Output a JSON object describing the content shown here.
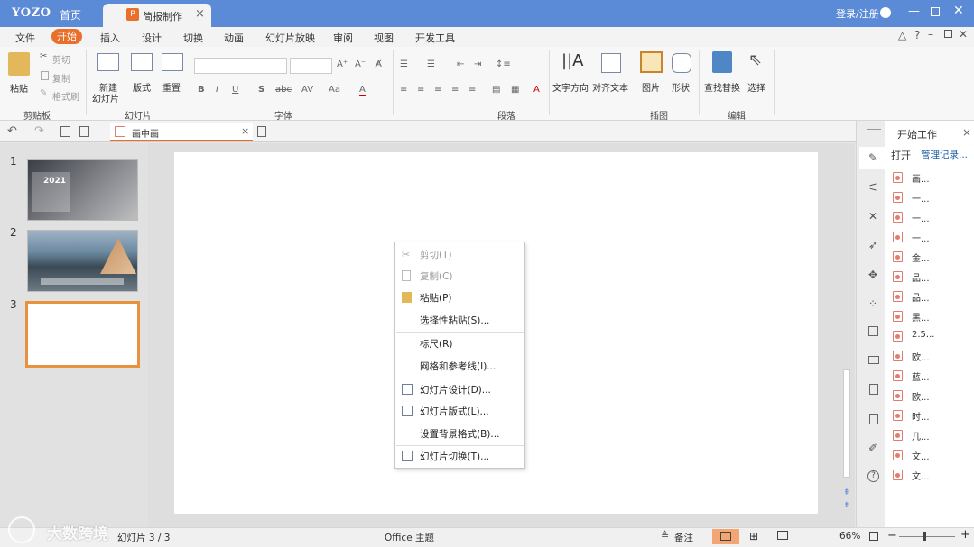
{
  "titlebar": {
    "logo": "YOZO",
    "home_tab": "首页",
    "doc_tab": "简报制作",
    "doc_icon": "P",
    "login": "登录/注册"
  },
  "menu": [
    "文件",
    "开始",
    "插入",
    "设计",
    "切换",
    "动画",
    "幻灯片放映",
    "审阅",
    "视图",
    "开发工具"
  ],
  "ribbon": {
    "paste": "粘贴",
    "cut": "剪切",
    "copy": "复制",
    "format_painter": "格式刷",
    "group_clipboard": "剪贴板",
    "new_slide_1": "新建",
    "new_slide_2": "幻灯片",
    "layout": "版式",
    "reset": "重置",
    "group_slides": "幻灯片",
    "group_font": "字体",
    "group_paragraph": "段落",
    "text_direction": "文字方向",
    "align_text": "对齐文本",
    "picture": "图片",
    "shape": "形状",
    "group_illustration": "插图",
    "find_replace": "查找替换",
    "select": "选择",
    "group_edit": "编辑"
  },
  "quickbar": {
    "doc_name": "画中画"
  },
  "thumbnails": [
    {
      "num": "1",
      "year": "2021"
    },
    {
      "num": "2"
    },
    {
      "num": "3"
    }
  ],
  "context_menu": {
    "cut": "剪切(T)",
    "copy": "复制(C)",
    "paste": "粘贴(P)",
    "paste_special": "选择性粘贴(S)...",
    "ruler": "标尺(R)",
    "grid": "网格和参考线(I)...",
    "slide_design": "幻灯片设计(D)...",
    "slide_layout": "幻灯片版式(L)...",
    "bg_format": "设置背景格式(B)...",
    "slide_transition": "幻灯片切换(T)..."
  },
  "right_panel": {
    "title": "开始工作",
    "open": "打开",
    "manage": "管理记录...",
    "files": [
      "画...",
      "一...",
      "一...",
      "一...",
      "金...",
      "品...",
      "品...",
      "黑...",
      "2.5...",
      "欧...",
      "蓝...",
      "欧...",
      "时...",
      "几...",
      "文...",
      "文..."
    ]
  },
  "status": {
    "slide": "幻灯片 3 / 3",
    "theme": "Office 主题",
    "notes": "备注",
    "zoom": "66%"
  },
  "watermark": "大数跨境",
  "colors": {
    "title_bar": "#5b8ad6",
    "accent": "#e8702b"
  }
}
